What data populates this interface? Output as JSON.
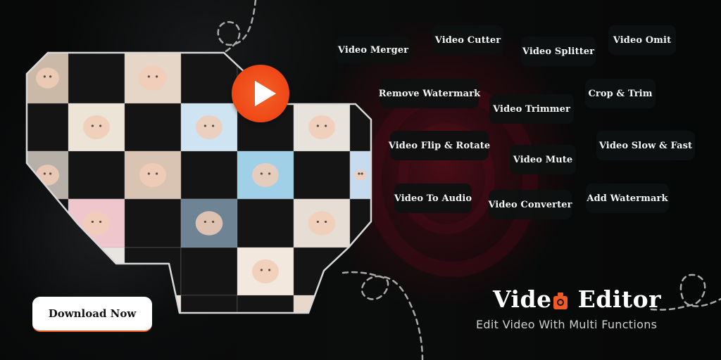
{
  "banner": {
    "features": [
      {
        "id": "video-merger",
        "label": "Video Merger"
      },
      {
        "id": "video-cutter",
        "label": "Video Cutter"
      },
      {
        "id": "video-splitter",
        "label": "Video Splitter"
      },
      {
        "id": "video-omit",
        "label": "Video Omit"
      },
      {
        "id": "remove-watermark",
        "label": "Remove Watermark"
      },
      {
        "id": "video-trimmer",
        "label": "Video Trimmer"
      },
      {
        "id": "crop-trim",
        "label": "Crop & Trim"
      },
      {
        "id": "video-flip-rotate",
        "label": "Video Flip & Rotate"
      },
      {
        "id": "video-mute",
        "label": "Video Mute"
      },
      {
        "id": "video-slow-fast",
        "label": "Video Slow & Fast"
      },
      {
        "id": "video-to-audio",
        "label": "Video To Audio"
      },
      {
        "id": "video-converter",
        "label": "Video Converter"
      },
      {
        "id": "add-watermark",
        "label": "Add Watermark"
      }
    ],
    "download_label": "Download Now",
    "logo": {
      "text_before_icon": "Vide",
      "text_after_icon": " Editor",
      "icon": "bottle-lens-icon"
    },
    "tagline": "Edit Video With Multi Functions",
    "play_icon": "play-icon",
    "colors": {
      "accent": "#f05a24",
      "pill_bg": "#0e1111",
      "cell_dark": "#141414",
      "text_light": "#f4f4f4"
    },
    "collage": {
      "description": "Checkerboard collage of baby photos",
      "photos": [
        {
          "id": "baby-smiling-lying",
          "tone": "#c9b9a6"
        },
        {
          "id": "newborn-in-basket",
          "tone": "#e6d6c8"
        },
        {
          "id": "newborn-headband",
          "tone": "#ece4d6"
        },
        {
          "id": "baby-blue-hood",
          "tone": "#cfe4f2"
        },
        {
          "id": "newborn-white-wrap",
          "tone": "#e8e2dc"
        },
        {
          "id": "toddler-lying",
          "tone": "#b7b0a8"
        },
        {
          "id": "baby-owl-hat",
          "tone": "#d9c4b4"
        },
        {
          "id": "baby-blue-hat",
          "tone": "#9fd0e8"
        },
        {
          "id": "baby-teddy-hood",
          "tone": "#c6dbee"
        },
        {
          "id": "baby-pink-flower",
          "tone": "#efc6cc"
        },
        {
          "id": "baby-knit-hat-sleeping",
          "tone": "#6e8494"
        },
        {
          "id": "baby-red-dress",
          "tone": "#e6ddd4"
        },
        {
          "id": "baby-bath-partial",
          "tone": "#e8e4e0"
        },
        {
          "id": "baby-towel-smile",
          "tone": "#f2e8de"
        },
        {
          "id": "baby-partial-bottom",
          "tone": "#ece4d8"
        },
        {
          "id": "baby-flower-crown",
          "tone": "#e8d8cc"
        }
      ]
    }
  }
}
